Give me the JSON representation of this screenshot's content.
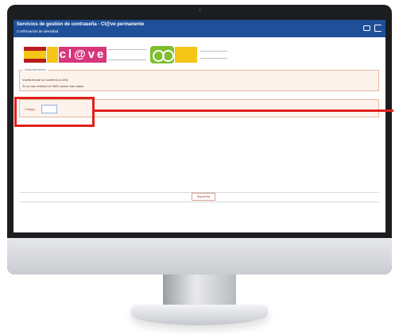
{
  "window": {
    "title": "Servicios de gestión de contraseña - Cl@ve permanente",
    "subtitle": "Confirmación de identidad"
  },
  "header": {
    "icons": [
      "print-icon",
      "logout-icon"
    ]
  },
  "logos": {
    "clave_text": "cl@ve"
  },
  "info_box": {
    "legend": "Aviso/acciones",
    "line1": "Vuelta fecha! se confirmó tu DNI.",
    "line2": "Si no has recibido el SMS vuelve tras datos."
  },
  "code_box": {
    "label": "Código:",
    "input_value": ""
  },
  "footer": {
    "button_label": "Siguiente"
  },
  "colors": {
    "header_bg": "#1f4f99",
    "clave_pink": "#d6377b",
    "highlight_red": "#e0201b",
    "panel_bg": "#fdf3ec"
  }
}
